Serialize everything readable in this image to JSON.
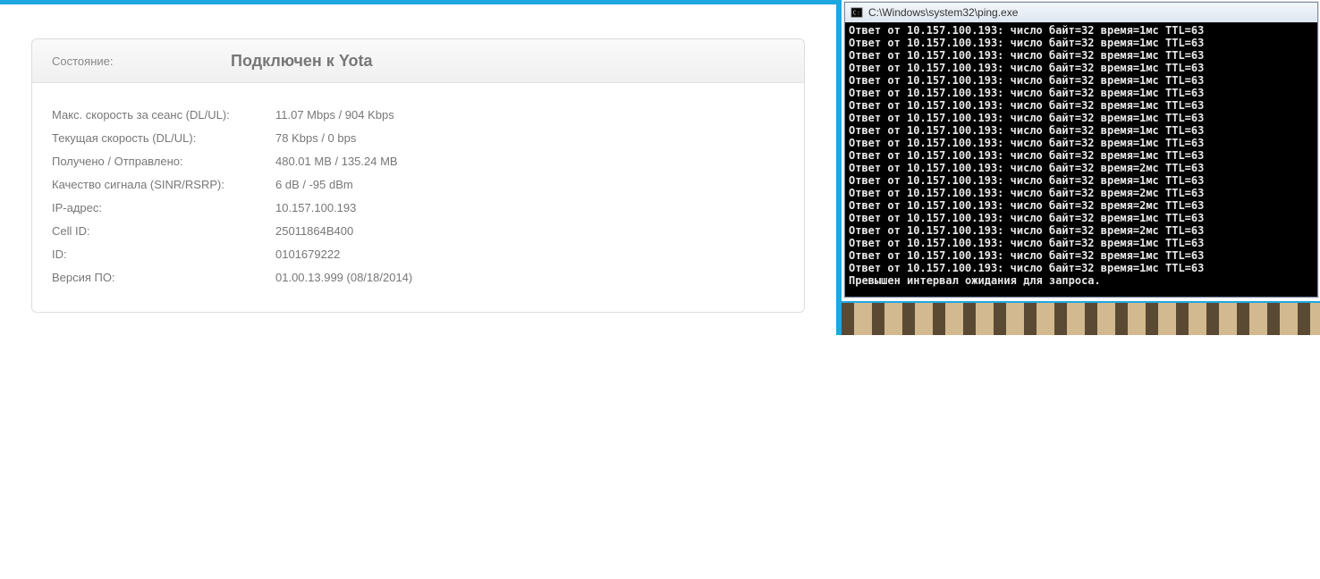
{
  "panel": {
    "state_label": "Состояние:",
    "state_value": "Подключен к Yota",
    "rows": [
      {
        "label": "Макс. скорость за сеанс (DL/UL):",
        "value": "11.07 Mbps / 904 Kbps"
      },
      {
        "label": "Текущая скорость (DL/UL):",
        "value": "78 Kbps / 0 bps"
      },
      {
        "label": "Получено / Отправлено:",
        "value": "480.01 MB / 135.24 MB"
      },
      {
        "label": "Качество сигнала (SINR/RSRP):",
        "value": "6 dB / -95 dBm"
      },
      {
        "label": "IP-адрес:",
        "value": "10.157.100.193"
      },
      {
        "label": "Cell ID:",
        "value": "25011864B400"
      },
      {
        "label": "ID:",
        "value": "0101679222"
      },
      {
        "label": "Версия ПО:",
        "value": "01.00.13.999 (08/18/2014)"
      }
    ]
  },
  "cmd": {
    "title": "C:\\Windows\\system32\\ping.exe",
    "lines": [
      "Ответ от 10.157.100.193: число байт=32 время=1мс TTL=63",
      "Ответ от 10.157.100.193: число байт=32 время=1мс TTL=63",
      "Ответ от 10.157.100.193: число байт=32 время=1мс TTL=63",
      "Ответ от 10.157.100.193: число байт=32 время=1мс TTL=63",
      "Ответ от 10.157.100.193: число байт=32 время=1мс TTL=63",
      "Ответ от 10.157.100.193: число байт=32 время=1мс TTL=63",
      "Ответ от 10.157.100.193: число байт=32 время=1мс TTL=63",
      "Ответ от 10.157.100.193: число байт=32 время=1мс TTL=63",
      "Ответ от 10.157.100.193: число байт=32 время=1мс TTL=63",
      "Ответ от 10.157.100.193: число байт=32 время=1мс TTL=63",
      "Ответ от 10.157.100.193: число байт=32 время=1мс TTL=63",
      "Ответ от 10.157.100.193: число байт=32 время=2мс TTL=63",
      "Ответ от 10.157.100.193: число байт=32 время=1мс TTL=63",
      "Ответ от 10.157.100.193: число байт=32 время=2мс TTL=63",
      "Ответ от 10.157.100.193: число байт=32 время=2мс TTL=63",
      "Ответ от 10.157.100.193: число байт=32 время=1мс TTL=63",
      "Ответ от 10.157.100.193: число байт=32 время=2мс TTL=63",
      "Ответ от 10.157.100.193: число байт=32 время=1мс TTL=63",
      "Ответ от 10.157.100.193: число байт=32 время=1мс TTL=63",
      "Ответ от 10.157.100.193: число байт=32 время=1мс TTL=63",
      "Превышен интервал ожидания для запроса."
    ]
  }
}
